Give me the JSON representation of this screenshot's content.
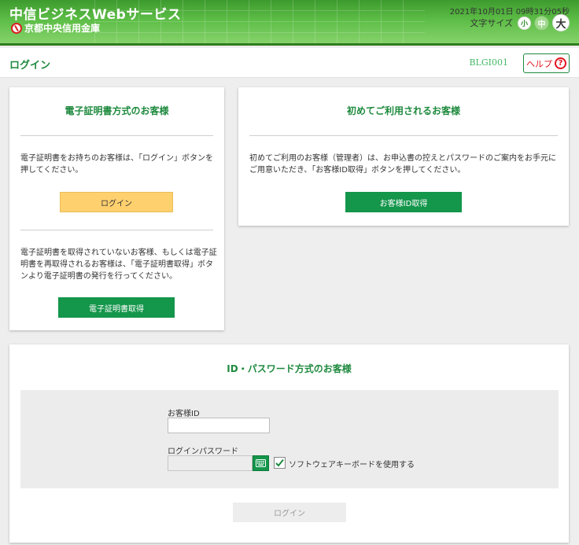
{
  "header": {
    "service_title": "中信ビジネスWebサービス",
    "bank_name": "京都中央信用金庫",
    "datetime": "2021年10月01日 09時31分05秒",
    "font_size_label": "文字サイズ",
    "font_small": "小",
    "font_medium": "中",
    "font_large": "大"
  },
  "titlebar": {
    "title": "ログイン",
    "screen_id": "BLGI001",
    "help_label": "ヘルプ",
    "help_icon_glyph": "?"
  },
  "certificate_card": {
    "title": "電子証明書方式のお客様",
    "text1": "電子証明書をお持ちのお客様は、「ログイン」ボタンを押してください。",
    "login_label": "ログイン",
    "text2": "電子証明書を取得されていないお客様、もしくは電子証明書を再取得されるお客様は、「電子証明書取得」ボタンより電子証明書の発行を行ってください。",
    "acquire_label": "電子証明書取得"
  },
  "first_time_card": {
    "title": "初めてご利用されるお客様",
    "text": "初めてご利用のお客様（管理者）は、お申込書の控えとパスワードのご案内をお手元にご用意いただき、「お客様ID取得」ボタンを押してください。",
    "acquire_id_label": "お客様ID取得"
  },
  "id_password_card": {
    "title": "ID・パスワード方式のお客様",
    "customer_id_label": "お客様ID",
    "customer_id_value": "",
    "password_label": "ログインパスワード",
    "password_value": "",
    "software_keyboard_label": "ソフトウェアキーボードを使用する",
    "software_keyboard_checked": true,
    "login_label": "ログイン"
  },
  "colors": {
    "brand_green": "#1e8a3e",
    "button_green": "#14964b",
    "button_yellow": "#ffd06e",
    "help_red": "#e0141e"
  }
}
